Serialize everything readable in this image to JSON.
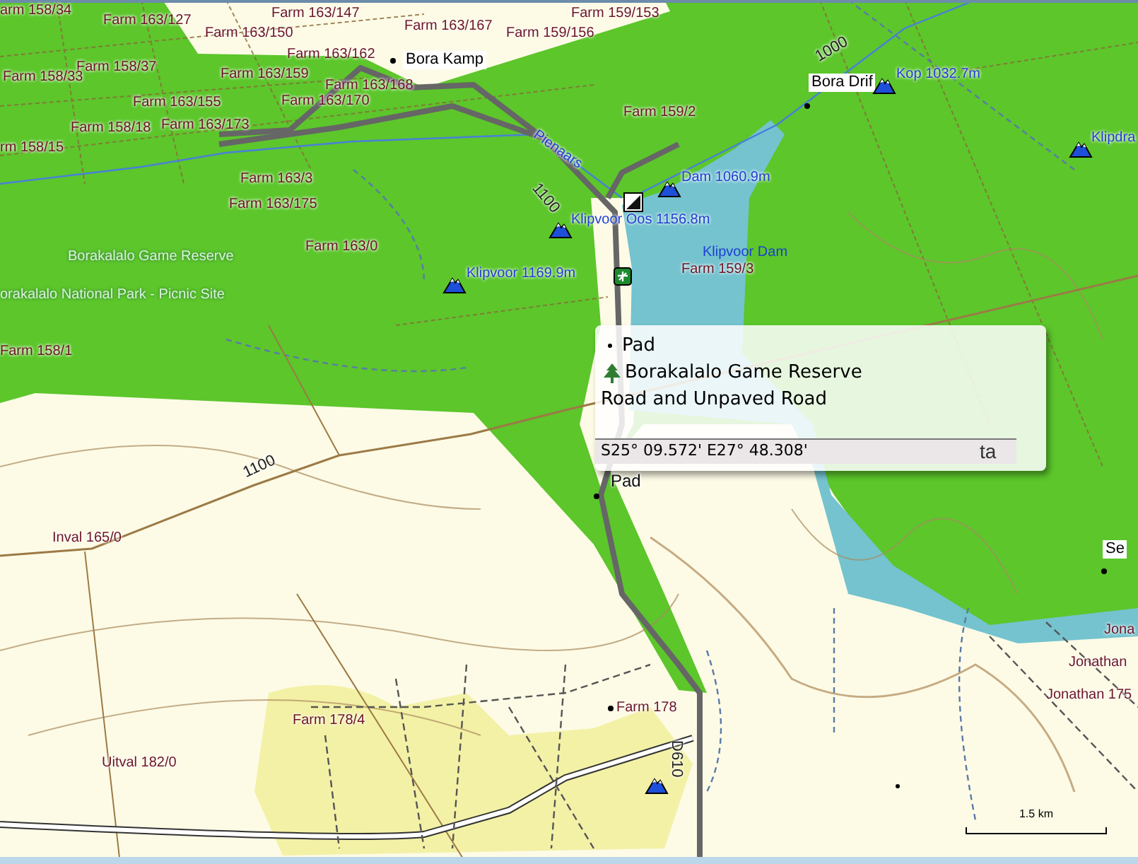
{
  "map": {
    "labels": [
      {
        "kind": "farm",
        "text": "arm 158/34"
      },
      {
        "kind": "farm",
        "text": "Farm 163/127"
      },
      {
        "kind": "farm",
        "text": "Farm 163/147"
      },
      {
        "kind": "farm",
        "text": "Farm 163/150"
      },
      {
        "kind": "farm",
        "text": "Farm 163/167"
      },
      {
        "kind": "farm",
        "text": "Farm 159/156"
      },
      {
        "kind": "farm",
        "text": "Farm 159/153"
      },
      {
        "kind": "farm",
        "text": "Farm 163/162"
      },
      {
        "kind": "farm",
        "text": "Farm 158/37"
      },
      {
        "kind": "place",
        "text": "Bora Kamp"
      },
      {
        "kind": "farm",
        "text": "Farm 158/33"
      },
      {
        "kind": "farm",
        "text": "Farm 163/159"
      },
      {
        "kind": "farm",
        "text": "Farm 163/168"
      },
      {
        "kind": "farm",
        "text": "Farm 163/155"
      },
      {
        "kind": "farm",
        "text": "Farm 163/170"
      },
      {
        "kind": "farm",
        "text": "Farm 158/18"
      },
      {
        "kind": "farm",
        "text": "Farm 163/173"
      },
      {
        "kind": "farm",
        "text": "rm 158/15"
      },
      {
        "kind": "river",
        "text": "Pienaars"
      },
      {
        "kind": "contour",
        "text": "1100"
      },
      {
        "kind": "farm",
        "text": "Farm 163/3"
      },
      {
        "kind": "farm",
        "text": "Farm 163/175"
      },
      {
        "kind": "farm",
        "text": "Farm 163/0"
      },
      {
        "kind": "reserve",
        "text": "Borakalalo Game Reserve"
      },
      {
        "kind": "reserve",
        "text": "orakalalo National Park - Picnic Site"
      },
      {
        "kind": "peak",
        "text": "Klipvoor 1169.9m"
      },
      {
        "kind": "farm",
        "text": "Farm 159/2"
      },
      {
        "kind": "contour",
        "text": "1000"
      },
      {
        "kind": "place",
        "text": "Bora Drif"
      },
      {
        "kind": "peak",
        "text": "Kop 1032.7m"
      },
      {
        "kind": "peak",
        "text": "Klipdra"
      },
      {
        "kind": "peak",
        "text": "Dam 1060.9m"
      },
      {
        "kind": "peak",
        "text": "Klipvoor Oos 1156.8m"
      },
      {
        "kind": "water",
        "text": "Klipvoor Dam"
      },
      {
        "kind": "farm",
        "text": "Farm 159/3"
      },
      {
        "kind": "farm",
        "text": "Farm 158/1"
      },
      {
        "kind": "contour",
        "text": "1100"
      },
      {
        "kind": "farm",
        "text": "Inval 165/0"
      },
      {
        "kind": "plain",
        "text": "ta"
      },
      {
        "kind": "point",
        "text": "Pad"
      },
      {
        "kind": "place",
        "text": "Se"
      },
      {
        "kind": "farm",
        "text": "Farm 178/4"
      },
      {
        "kind": "farm",
        "text": "Uitval 182/0"
      },
      {
        "kind": "farm",
        "text": "Farm 178"
      },
      {
        "kind": "road",
        "text": "D610"
      },
      {
        "kind": "farm",
        "text": "Jona"
      },
      {
        "kind": "farm",
        "text": "Jonathan"
      },
      {
        "kind": "farm",
        "text": "Jonathan 175"
      }
    ]
  },
  "popup": {
    "lines": [
      {
        "kind": "point",
        "text": "Pad"
      },
      {
        "kind": "area",
        "text": "Borakalalo Game Reserve"
      },
      {
        "kind": "plain",
        "text": "Road and Unpaved Road"
      }
    ],
    "coordinates": "S25° 09.572' E27° 48.308'"
  },
  "scale_bar": {
    "label": "1.5 km"
  }
}
